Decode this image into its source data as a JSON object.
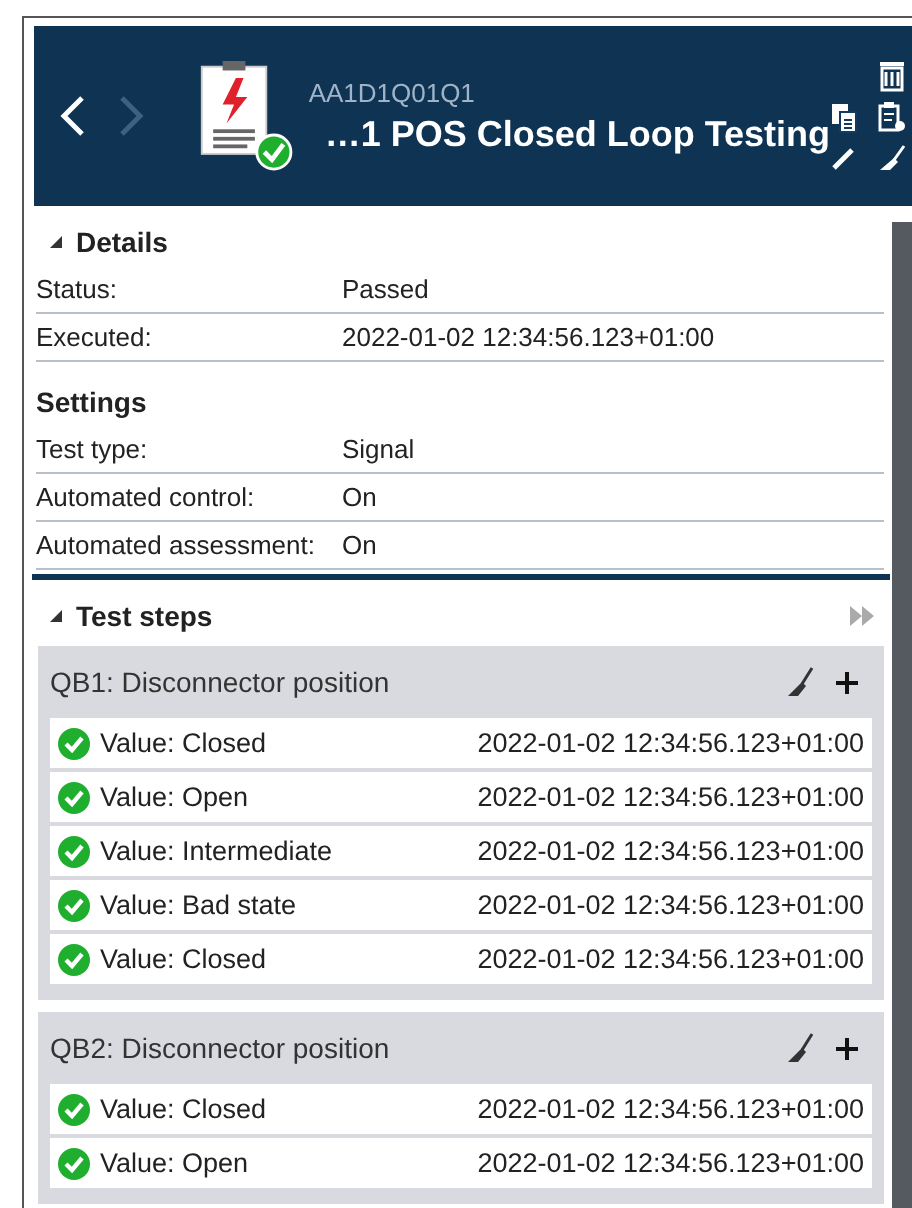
{
  "header": {
    "back_disabled": false,
    "forward_disabled": true,
    "passed": true,
    "subtitle": "AA1D1Q01Q1",
    "title": "…1 POS Closed Loop Testing"
  },
  "details": {
    "heading": "Details",
    "expanded": true,
    "rows": [
      {
        "label": "Status:",
        "value": "Passed"
      },
      {
        "label": "Executed:",
        "value": "2022-01-02 12:34:56.123+01:00"
      }
    ]
  },
  "settings": {
    "heading": "Settings",
    "rows": [
      {
        "label": "Test type:",
        "value": "Signal"
      },
      {
        "label": "Automated control:",
        "value": "On"
      },
      {
        "label": "Automated assessment:",
        "value": "On"
      }
    ]
  },
  "test_steps": {
    "heading": "Test steps",
    "expanded": true,
    "groups": [
      {
        "title": "QB1: Disconnector position",
        "steps": [
          {
            "label": "Value: Closed",
            "time": "2022-01-02 12:34:56.123+01:00",
            "passed": true
          },
          {
            "label": "Value: Open",
            "time": "2022-01-02 12:34:56.123+01:00",
            "passed": true
          },
          {
            "label": "Value: Intermediate",
            "time": "2022-01-02 12:34:56.123+01:00",
            "passed": true
          },
          {
            "label": "Value: Bad state",
            "time": "2022-01-02 12:34:56.123+01:00",
            "passed": true
          },
          {
            "label": "Value: Closed",
            "time": "2022-01-02 12:34:56.123+01:00",
            "passed": true
          }
        ]
      },
      {
        "title": "QB2: Disconnector position",
        "steps": [
          {
            "label": "Value: Closed",
            "time": "2022-01-02 12:34:56.123+01:00",
            "passed": true
          },
          {
            "label": "Value: Open",
            "time": "2022-01-02 12:34:56.123+01:00",
            "passed": true
          }
        ]
      }
    ]
  }
}
